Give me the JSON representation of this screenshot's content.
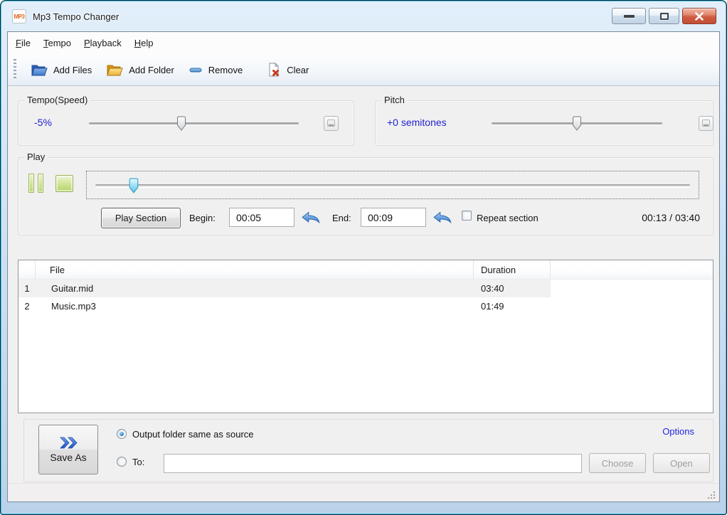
{
  "window": {
    "title": "Mp3 Tempo Changer",
    "icon_label": "MP3"
  },
  "menu": {
    "items": [
      {
        "label": "File"
      },
      {
        "label": "Tempo"
      },
      {
        "label": "Playback"
      },
      {
        "label": "Help"
      }
    ]
  },
  "toolbar": {
    "add_files": "Add Files",
    "add_folder": "Add Folder",
    "remove": "Remove",
    "clear": "Clear"
  },
  "tempo": {
    "legend": "Tempo(Speed)",
    "value": "-5%",
    "slider_percent": 44
  },
  "pitch": {
    "legend": "Pitch",
    "value": "+0 semitones",
    "slider_percent": 50
  },
  "play": {
    "legend": "Play",
    "position_percent": 6.5,
    "play_section_label": "Play Section",
    "begin_label": "Begin:",
    "begin_value": "00:05",
    "end_label": "End:",
    "end_value": "00:09",
    "repeat_label": "Repeat section",
    "repeat_checked": false,
    "time_display": "00:13 / 03:40"
  },
  "file_list": {
    "columns": {
      "num": "",
      "file": "File",
      "duration": "Duration"
    },
    "rows": [
      {
        "num": "1",
        "file": "Guitar.mid",
        "duration": "03:40"
      },
      {
        "num": "2",
        "file": "Music.mp3",
        "duration": "01:49"
      }
    ]
  },
  "output": {
    "save_as_label": "Save As",
    "same_as_source_label": "Output folder same as source",
    "same_as_source_selected": true,
    "to_label": "To:",
    "to_value": "",
    "choose_label": "Choose",
    "open_label": "Open",
    "options_label": "Options"
  },
  "icons": {
    "app": "mp3-badge",
    "add_files": "folder-open-blue",
    "add_folder": "folder-open-yellow",
    "remove": "minus-bar",
    "clear": "page-red-x",
    "pause": "pause-bars",
    "stop": "stop-square",
    "set_time": "undo-arrow",
    "save_as": "double-chevron-right"
  },
  "colors": {
    "value_text": "#1f1fd2",
    "link": "#2424e0",
    "frame_accent": "#45c4e6",
    "close_red": "#c14f36"
  }
}
